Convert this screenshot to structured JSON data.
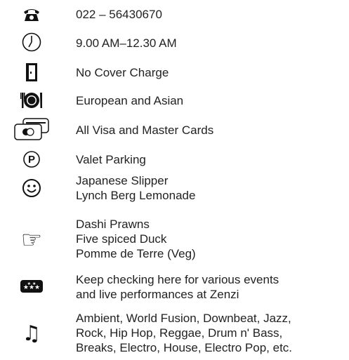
{
  "items": [
    {
      "icon": "telephone-icon",
      "lines": [
        "022 – 56430670"
      ]
    },
    {
      "icon": "clock-icon",
      "lines": [
        "9.00 AM–12.30 AM"
      ]
    },
    {
      "icon": "door-icon",
      "lines": [
        "No Cover Charge"
      ]
    },
    {
      "icon": "dining-plate-icon",
      "lines": [
        "European and Asian"
      ]
    },
    {
      "icon": "credit-cards-icon",
      "lines": [
        "All Visa and Master Cards"
      ]
    },
    {
      "icon": "parking-icon",
      "lines": [
        "Valet Parking"
      ]
    },
    {
      "icon": "smiley-icon",
      "lines": [
        "Japanese Slipper",
        "Lynch Berg Lemonade"
      ]
    },
    {
      "icon": "pointing-hand-icon",
      "lines": [
        "Dashi Prawns",
        "Five spiced Duck",
        "Pomme de Terre (Veg)"
      ]
    },
    {
      "icon": "stars-ticket-icon",
      "lines": [
        "Keep checking here for various events",
        "and live performances at Zenzi"
      ]
    },
    {
      "icon": "music-note-icon",
      "lines": [
        "Ambient, World Fusion, Downbeat, Jazz,",
        "Rock, Hip Hop, Reggae, Drum n' Bass,",
        "Breaks, Electro, House, Electro Pop, etc."
      ]
    }
  ]
}
